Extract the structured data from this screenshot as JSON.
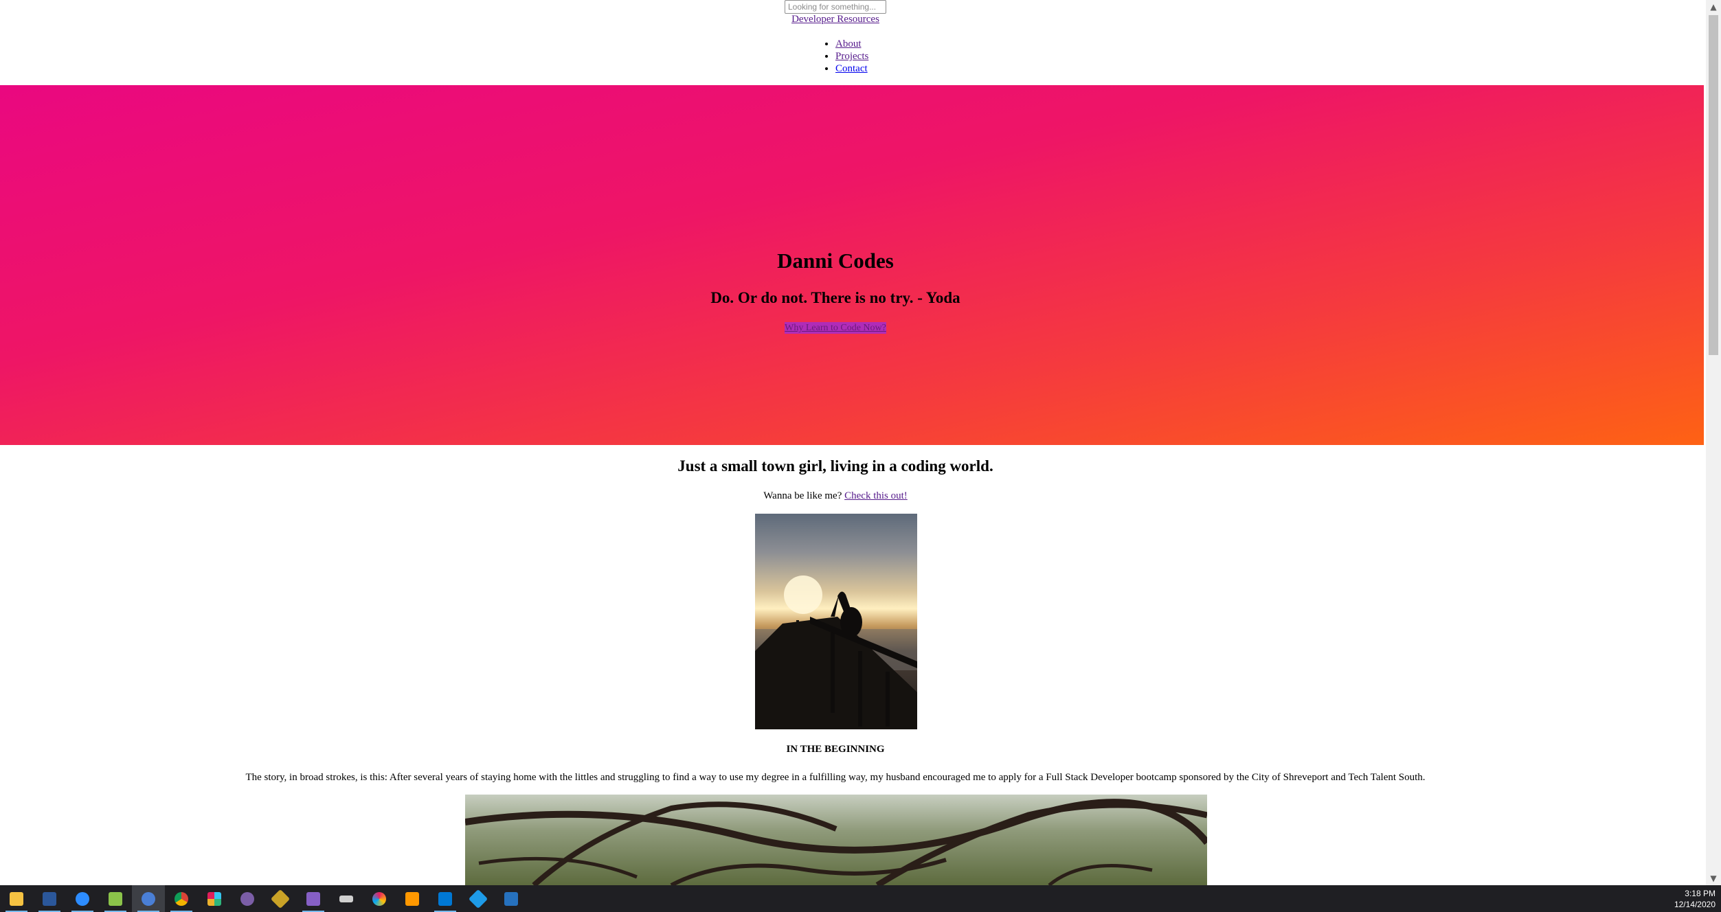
{
  "header": {
    "search_placeholder": "Looking for something...",
    "dev_resources_label": "Developer Resources",
    "nav": [
      "About",
      "Projects",
      "Contact"
    ]
  },
  "hero": {
    "title": "Danni Codes",
    "quote": "Do. Or do not. There is no try. - Yoda",
    "cta_label": "Why Learn to Code Now?"
  },
  "intro": {
    "tagline": "Just a small town girl, living in a coding world.",
    "wanna_text": "Wanna be like me?",
    "wanna_link": "Check this out!"
  },
  "story": {
    "section_title": "IN THE BEGINNING",
    "paragraph": "The story, in broad strokes, is this: After several years of staying home with the littles and struggling to find a way to use my degree in a fulfilling way, my husband encouraged me to apply for a Full Stack Developer bootcamp sponsored by the City of Shreveport and Tech Talent South."
  },
  "taskbar": {
    "apps": [
      "file-explorer",
      "word",
      "zoom",
      "spreadsheet",
      "firefox",
      "chrome",
      "slack",
      "zoom-chat",
      "git-kraken",
      "visual-studio",
      "keyboard-tool",
      "paint",
      "sublime-text",
      "vscode",
      "git",
      "powershell"
    ],
    "time": "3:18 PM",
    "date": "12/14/2020"
  },
  "colors": {
    "hero_top": "#ea0880",
    "hero_bottom": "#fe6214",
    "cta_bg": "#b02cb8",
    "taskbar_bg": "#1f1f23"
  }
}
